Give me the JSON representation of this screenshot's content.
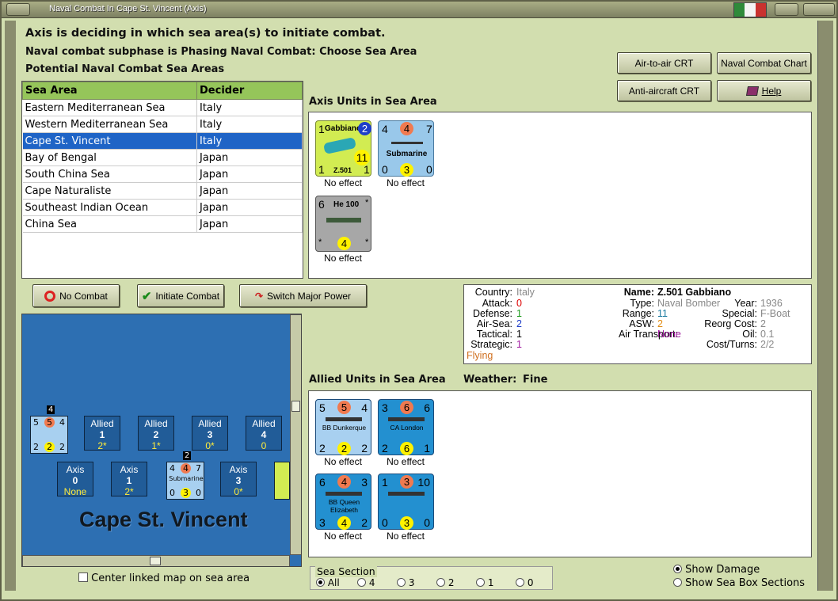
{
  "title": "Naval Combat In Cape St. Vincent (Axis)",
  "heading": "Axis is deciding in which sea area(s) to initiate combat.",
  "subphase": "Naval combat subphase is Phasing Naval Combat: Choose Sea Area",
  "potential_label": "Potential Naval Combat Sea Areas",
  "table": {
    "headers": [
      "Sea Area",
      "Decider"
    ],
    "rows": [
      {
        "area": "Eastern Mediterranean Sea",
        "decider": "Italy"
      },
      {
        "area": "Western Mediterranean Sea",
        "decider": "Italy"
      },
      {
        "area": "Cape St. Vincent",
        "decider": "Italy",
        "selected": true
      },
      {
        "area": "Bay of Bengal",
        "decider": "Japan"
      },
      {
        "area": "South China Sea",
        "decider": "Japan"
      },
      {
        "area": "Cape Naturaliste",
        "decider": "Japan"
      },
      {
        "area": "Southeast Indian Ocean",
        "decider": "Japan"
      },
      {
        "area": "China Sea",
        "decider": "Japan"
      }
    ]
  },
  "buttons": {
    "air_to_air": "Air-to-air CRT",
    "naval_chart": "Naval Combat Chart",
    "antiaircraft": "Anti-aircraft CRT",
    "help": "Help",
    "no_combat": "No Combat",
    "initiate": "Initiate Combat",
    "switch": "Switch Major Power"
  },
  "axis_units_label": "Axis Units in Sea Area",
  "allied_units_label": "Allied Units in Sea Area",
  "weather_label": "Weather:",
  "weather_value": "Fine",
  "axis_units": [
    {
      "name": "Gabbiano",
      "sub": "Z.501",
      "tl": "1",
      "tr": "2",
      "big": "11",
      "bl": "1",
      "br": "1",
      "caption": "No effect"
    },
    {
      "name": "Submarine",
      "tl": "4",
      "tm": "4",
      "tr": "7",
      "bl": "0",
      "bm": "3",
      "br": "0",
      "caption": "No effect"
    },
    {
      "name": "He 100",
      "tl": "6",
      "tr": "*",
      "bl": "*",
      "bm": "4",
      "br": "*",
      "caption": "No effect"
    }
  ],
  "allied_units": [
    {
      "name": "BB Dunkerque",
      "tl": "5",
      "tm": "5",
      "tr": "4",
      "bl": "2",
      "bm": "2",
      "br": "2",
      "caption": "No effect"
    },
    {
      "name": "CA London",
      "tl": "3",
      "tm": "6",
      "tr": "6",
      "bl": "2",
      "bm": "6",
      "br": "1",
      "caption": "No effect"
    },
    {
      "name": "BB Queen Elizabeth",
      "tl": "6",
      "tm": "4",
      "tr": "3",
      "bl": "3",
      "bm": "4",
      "br": "2",
      "caption": "No effect"
    },
    {
      "name": "",
      "tl": "1",
      "tm": "3",
      "tr": "10",
      "bl": "0",
      "bm": "3",
      "br": "0",
      "caption": "No effect"
    }
  ],
  "info": {
    "country_l": "Country:",
    "country": "Italy",
    "attack_l": "Attack:",
    "attack": "0",
    "defense_l": "Defense:",
    "defense": "1",
    "airsea_l": "Air-Sea:",
    "airsea": "2",
    "tactical_l": "Tactical:",
    "tactical": "1",
    "strategic_l": "Strategic:",
    "strategic": "1",
    "flying": "Flying",
    "name_l": "Name:",
    "name": "Z.501 Gabbiano",
    "type_l": "Type:",
    "type": "Naval Bomber",
    "year_l": "Year:",
    "year": "1936",
    "range_l": "Range:",
    "range": "11",
    "special_l": "Special:",
    "special": "F-Boat",
    "asw_l": "ASW:",
    "asw": "2",
    "reorg_l": "Reorg Cost:",
    "reorg": "2",
    "airtrans_l": "Air Transport:",
    "airtrans": "None",
    "oil_l": "Oil:",
    "oil": "0.1",
    "cost_l": "Cost/Turns:",
    "cost": "2/2"
  },
  "map": {
    "name": "Cape St. Vincent",
    "allied_boxes": [
      {
        "label": "Allied",
        "num": "1",
        "val": "2*"
      },
      {
        "label": "Allied",
        "num": "2",
        "val": "1*"
      },
      {
        "label": "Allied",
        "num": "3",
        "val": "0*"
      },
      {
        "label": "Allied",
        "num": "4",
        "val": "0"
      }
    ],
    "axis_boxes": [
      {
        "label": "Axis",
        "num": "0",
        "val": "None"
      },
      {
        "label": "Axis",
        "num": "1",
        "val": "2*"
      },
      {
        "label": "Axis",
        "num": "3",
        "val": "0*"
      }
    ],
    "stack_a": "4",
    "stack_b": "2"
  },
  "center_map": "Center linked map on sea area",
  "sea_section": {
    "label": "Sea Section",
    "options": [
      "All",
      "4",
      "3",
      "2",
      "1",
      "0"
    ],
    "selected": "All"
  },
  "show_damage": "Show Damage",
  "show_sections": "Show Sea Box Sections",
  "colors": {
    "panel_bg": "#d2deaf",
    "selected": "#1f64c6",
    "header": "#95c55a",
    "sea": "#2d6fb2"
  }
}
